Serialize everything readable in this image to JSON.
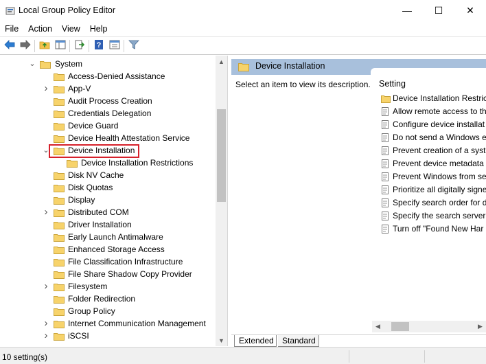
{
  "window": {
    "title": "Local Group Policy Editor",
    "minimize_glyph": "—",
    "maximize_glyph": "☐",
    "close_glyph": "✕"
  },
  "menu": [
    "File",
    "Action",
    "View",
    "Help"
  ],
  "toolbar": {
    "icons": [
      "back-icon",
      "forward-icon",
      "up-folder-icon",
      "show-hide-tree-icon",
      "export-list-icon",
      "help-icon",
      "properties-icon",
      "filter-icon"
    ]
  },
  "tree": {
    "system_label": "System",
    "items": [
      {
        "label": "Access-Denied Assistance",
        "expandable": false
      },
      {
        "label": "App-V",
        "expandable": true
      },
      {
        "label": "Audit Process Creation",
        "expandable": false
      },
      {
        "label": "Credentials Delegation",
        "expandable": false
      },
      {
        "label": "Device Guard",
        "expandable": false
      },
      {
        "label": "Device Health Attestation Service",
        "expandable": false
      },
      {
        "label": "Device Installation",
        "expandable": true,
        "expanded": true,
        "selected": true
      },
      {
        "label": "Device Installation Restrictions",
        "child": true
      },
      {
        "label": "Disk NV Cache",
        "expandable": false
      },
      {
        "label": "Disk Quotas",
        "expandable": false
      },
      {
        "label": "Display",
        "expandable": false
      },
      {
        "label": "Distributed COM",
        "expandable": true
      },
      {
        "label": "Driver Installation",
        "expandable": false
      },
      {
        "label": "Early Launch Antimalware",
        "expandable": false
      },
      {
        "label": "Enhanced Storage Access",
        "expandable": false
      },
      {
        "label": "File Classification Infrastructure",
        "expandable": false
      },
      {
        "label": "File Share Shadow Copy Provider",
        "expandable": false
      },
      {
        "label": "Filesystem",
        "expandable": true
      },
      {
        "label": "Folder Redirection",
        "expandable": false
      },
      {
        "label": "Group Policy",
        "expandable": false
      },
      {
        "label": "Internet Communication Management",
        "expandable": true
      },
      {
        "label": "iSCSI",
        "expandable": true
      }
    ]
  },
  "right": {
    "header": "Device Installation",
    "description": "Select an item to view its description.",
    "column_header": "Setting",
    "settings": [
      {
        "label": "Device Installation Restric",
        "type": "folder"
      },
      {
        "label": "Allow remote access to th",
        "type": "policy"
      },
      {
        "label": "Configure device installat",
        "type": "policy"
      },
      {
        "label": "Do not send a Windows e",
        "type": "policy"
      },
      {
        "label": "Prevent creation of a syst",
        "type": "policy"
      },
      {
        "label": "Prevent device metadata",
        "type": "policy"
      },
      {
        "label": "Prevent Windows from se",
        "type": "policy"
      },
      {
        "label": "Prioritize all digitally signe",
        "type": "policy"
      },
      {
        "label": "Specify search order for d",
        "type": "policy"
      },
      {
        "label": "Specify the search server",
        "type": "policy"
      },
      {
        "label": "Turn off \"Found New Har",
        "type": "policy"
      }
    ]
  },
  "tabs": {
    "extended": "Extended",
    "standard": "Standard"
  },
  "status": {
    "text": "10 setting(s)"
  },
  "colors": {
    "header_bg": "#a8c0dc",
    "folder": "#f3c24b",
    "highlight": "#d6202a"
  }
}
